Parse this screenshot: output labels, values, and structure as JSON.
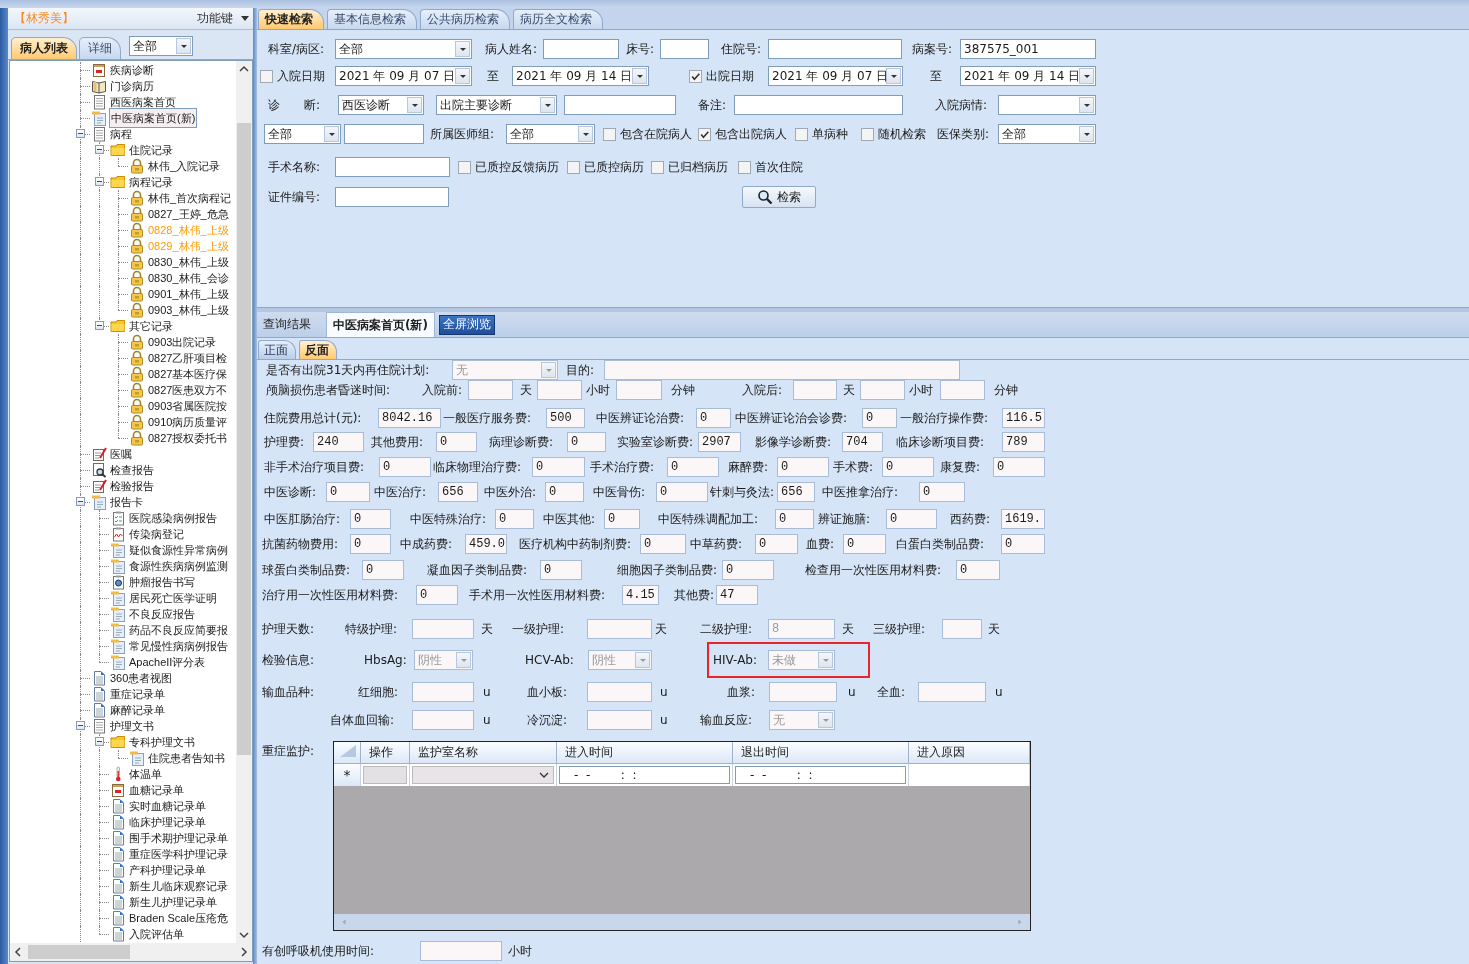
{
  "left_panel": {
    "patient_name": "【林秀美】",
    "function_key": "功能键",
    "tabs": [
      {
        "label": "病人列表",
        "selected": true
      },
      {
        "label": "详细",
        "selected": false
      }
    ],
    "filter": {
      "value": "全部"
    },
    "tree": [
      {
        "label": "疾病诊断",
        "kind": "calendar",
        "selected": false
      },
      {
        "label": "门诊病历",
        "kind": "book",
        "selected": false
      },
      {
        "label": "西医病案首页",
        "kind": "doc",
        "selected": false
      },
      {
        "label": "中医病案首页(新)",
        "kind": "card",
        "selected": true
      },
      {
        "label": "病程",
        "kind": "doc",
        "selected": false,
        "expanded": true,
        "children": [
          {
            "label": "住院记录",
            "kind": "folder",
            "selected": false,
            "expanded": true,
            "children": [
              {
                "label": "林伟_入院记录",
                "kind": "lock",
                "selected": false
              }
            ]
          },
          {
            "label": "病程记录",
            "kind": "folder",
            "selected": false,
            "expanded": true,
            "children": [
              {
                "label": "林伟_首次病程记",
                "kind": "lock",
                "selected": false
              },
              {
                "label": "0827_王婷_危急",
                "kind": "lock",
                "selected": false
              },
              {
                "label": "0828_林伟_上级",
                "kind": "lock",
                "selected": false,
                "color": "#ff9c00"
              },
              {
                "label": "0829_林伟_上级",
                "kind": "lock",
                "selected": false,
                "color": "#ff9c00"
              },
              {
                "label": "0830_林伟_上级",
                "kind": "lock",
                "selected": false
              },
              {
                "label": "0830_林伟_会诊",
                "kind": "lock",
                "selected": false
              },
              {
                "label": "0901_林伟_上级",
                "kind": "lock",
                "selected": false
              },
              {
                "label": "0903_林伟_上级",
                "kind": "lock",
                "selected": false
              }
            ]
          },
          {
            "label": "其它记录",
            "kind": "folder",
            "selected": false,
            "expanded": true,
            "children": [
              {
                "label": "0903出院记录",
                "kind": "lock",
                "selected": false
              },
              {
                "label": "0827乙肝项目检",
                "kind": "lock",
                "selected": false
              },
              {
                "label": "0827基本医疗保",
                "kind": "lock",
                "selected": false
              },
              {
                "label": "0827医患双方不",
                "kind": "lock",
                "selected": false
              },
              {
                "label": "0903省属医院按",
                "kind": "lock",
                "selected": false
              },
              {
                "label": "0910病历质量评",
                "kind": "lock",
                "selected": false
              },
              {
                "label": "0827授权委托书",
                "kind": "lock",
                "selected": false
              }
            ]
          }
        ]
      },
      {
        "label": "医嘱",
        "kind": "pen",
        "selected": false
      },
      {
        "label": "检查报告",
        "kind": "lens",
        "selected": false
      },
      {
        "label": "检验报告",
        "kind": "pen",
        "selected": false
      },
      {
        "label": "报告卡",
        "kind": "card",
        "selected": false,
        "expanded": true,
        "children": [
          {
            "label": "医院感染病例报告",
            "kind": "checklist",
            "selected": false
          },
          {
            "label": "传染病登记",
            "kind": "chart",
            "selected": false
          },
          {
            "label": "疑似食源性异常病例",
            "kind": "card",
            "selected": false
          },
          {
            "label": "食源性疾病病例监测",
            "kind": "card",
            "selected": false
          },
          {
            "label": "肿瘤报告书写",
            "kind": "clipboard",
            "selected": false
          },
          {
            "label": "居民死亡医学证明",
            "kind": "card",
            "selected": false
          },
          {
            "label": "不良反应报告",
            "kind": "card",
            "selected": false
          },
          {
            "label": "药品不良反应简要报",
            "kind": "card",
            "selected": false
          },
          {
            "label": "常见慢性病病例报告",
            "kind": "card",
            "selected": false
          },
          {
            "label": "ApacheII评分表",
            "kind": "card",
            "selected": false
          }
        ]
      },
      {
        "label": "360患者视图",
        "kind": "page",
        "selected": false
      },
      {
        "label": "重症记录单",
        "kind": "page",
        "selected": false
      },
      {
        "label": "麻醉记录单",
        "kind": "page",
        "selected": false
      },
      {
        "label": "护理文书",
        "kind": "doc",
        "selected": false,
        "expanded": true,
        "children": [
          {
            "label": "专科护理文书",
            "kind": "folder",
            "selected": false,
            "expanded": true,
            "children": [
              {
                "label": "住院患者告知书",
                "kind": "card",
                "selected": false
              }
            ]
          },
          {
            "label": "体温单",
            "kind": "thermometer",
            "selected": false
          },
          {
            "label": "血糖记录单",
            "kind": "calendar",
            "selected": false
          },
          {
            "label": "实时血糖记录单",
            "kind": "page",
            "selected": false
          },
          {
            "label": "临床护理记录单",
            "kind": "page",
            "selected": false
          },
          {
            "label": "围手术期护理记录单",
            "kind": "page",
            "selected": false
          },
          {
            "label": "重症医学科护理记录",
            "kind": "page",
            "selected": false
          },
          {
            "label": "产科护理记录单",
            "kind": "page",
            "selected": false
          },
          {
            "label": "新生儿临床观察记录",
            "kind": "page",
            "selected": false
          },
          {
            "label": "新生儿护理记录单",
            "kind": "page",
            "selected": false
          },
          {
            "label": "Braden Scale压疮危",
            "kind": "page",
            "selected": false
          },
          {
            "label": "入院评估单",
            "kind": "page",
            "selected": false
          }
        ]
      }
    ]
  },
  "search_tabs": [
    {
      "label": "快速检索",
      "selected": true
    },
    {
      "label": "基本信息检索",
      "selected": false
    },
    {
      "label": "公共病历检索",
      "selected": false
    },
    {
      "label": "病历全文检索",
      "selected": false
    }
  ],
  "query_form": {
    "rows": [
      {
        "items": [
          {
            "kind": "label",
            "text": "科室/病区:"
          },
          {
            "kind": "select",
            "value": "全部"
          },
          {
            "kind": "label",
            "text": "病人姓名:"
          },
          {
            "kind": "field"
          },
          {
            "kind": "label",
            "text": "床号:"
          },
          {
            "kind": "field"
          },
          {
            "kind": "label",
            "text": "住院号:"
          },
          {
            "kind": "field"
          },
          {
            "kind": "label",
            "text": "病案号:"
          },
          {
            "kind": "field",
            "value": "387575_001"
          }
        ]
      },
      {
        "items": [
          {
            "kind": "check",
            "text": "入院日期",
            "checked": false
          },
          {
            "kind": "date",
            "value": "2021 年 09 月 07 日"
          },
          {
            "kind": "label",
            "text": "至"
          },
          {
            "kind": "date",
            "value": "2021 年 09 月 14 日"
          },
          {
            "kind": "check",
            "text": "出院日期",
            "checked": true
          },
          {
            "kind": "date",
            "value": "2021 年 09 月 07 日"
          },
          {
            "kind": "label",
            "text": "至"
          },
          {
            "kind": "date",
            "value": "2021 年 09 月 14 日"
          }
        ]
      },
      {
        "items": [
          {
            "kind": "label",
            "text": "诊　　断:"
          },
          {
            "kind": "select",
            "value": "西医诊断"
          },
          {
            "kind": "select",
            "value": "出院主要诊断"
          },
          {
            "kind": "field"
          },
          {
            "kind": "label",
            "text": "备注:"
          },
          {
            "kind": "field"
          },
          {
            "kind": "label",
            "text": "入院病情:"
          },
          {
            "kind": "select"
          }
        ]
      },
      {
        "items": [
          {
            "kind": "select",
            "value": "全部"
          },
          {
            "kind": "field"
          },
          {
            "kind": "label",
            "text": "所属医师组:"
          },
          {
            "kind": "select",
            "value": "全部"
          },
          {
            "kind": "check",
            "text": "包含在院病人",
            "checked": false
          },
          {
            "kind": "check",
            "text": "包含出院病人",
            "checked": true
          },
          {
            "kind": "check",
            "text": "单病种",
            "checked": false
          },
          {
            "kind": "check",
            "text": "随机检索",
            "checked": false
          },
          {
            "kind": "label",
            "text": "医保类别:"
          },
          {
            "kind": "select",
            "value": "全部"
          }
        ]
      },
      {
        "items": [
          {
            "kind": "label",
            "text": "手术名称:"
          },
          {
            "kind": "field"
          },
          {
            "kind": "check",
            "text": "已质控反馈病历",
            "checked": false
          },
          {
            "kind": "check",
            "text": "已质控病历",
            "checked": false
          },
          {
            "kind": "check",
            "text": "已归档病历",
            "checked": false
          },
          {
            "kind": "check",
            "text": "首次住院",
            "checked": false
          }
        ]
      },
      {
        "items": [
          {
            "kind": "label",
            "text": "证件编号:"
          },
          {
            "kind": "field"
          },
          {
            "kind": "button",
            "text": "检索"
          }
        ]
      }
    ]
  },
  "result_tabs": [
    {
      "label": "查询结果",
      "selected": false
    },
    {
      "label": "中医病案首页(新)",
      "selected": true
    }
  ],
  "fullscreen_button": "全屏浏览",
  "page_tabs": [
    {
      "label": "正面",
      "selected": false
    },
    {
      "label": "反面",
      "selected": true
    }
  ],
  "back_page": {
    "rows": [
      {
        "items": [
          {
            "kind": "label",
            "text": "是否有出院31天内再住院计划:"
          },
          {
            "kind": "select",
            "value": "无",
            "disabled": true
          },
          {
            "kind": "label",
            "text": "目的:"
          },
          {
            "kind": "field"
          }
        ]
      },
      {
        "items": [
          {
            "kind": "label",
            "text": "颅脑损伤患者昏迷时间:"
          },
          {
            "kind": "label",
            "text": "入院前:"
          },
          {
            "kind": "field"
          },
          {
            "kind": "unit",
            "text": "天"
          },
          {
            "kind": "field"
          },
          {
            "kind": "unit",
            "text": "小时"
          },
          {
            "kind": "field"
          },
          {
            "kind": "unit",
            "text": "分钟"
          },
          {
            "kind": "label",
            "text": "入院后:"
          },
          {
            "kind": "field"
          },
          {
            "kind": "unit",
            "text": "天"
          },
          {
            "kind": "field"
          },
          {
            "kind": "unit",
            "text": "小时"
          },
          {
            "kind": "field"
          },
          {
            "kind": "unit",
            "text": "分钟"
          }
        ]
      },
      {
        "items": [
          {
            "kind": "label",
            "text": "住院费用总计(元):"
          },
          {
            "kind": "field",
            "value": "8042.16"
          },
          {
            "kind": "label",
            "text": "一般医疗服务费:"
          },
          {
            "kind": "field",
            "value": "500"
          },
          {
            "kind": "label",
            "text": "中医辨证论治费:"
          },
          {
            "kind": "field",
            "value": "0"
          },
          {
            "kind": "label",
            "text": "中医辨证论治会诊费:"
          },
          {
            "kind": "field",
            "value": "0"
          },
          {
            "kind": "label",
            "text": "一般治疗操作费:"
          },
          {
            "kind": "field",
            "value": "116.5"
          }
        ]
      },
      {
        "items": [
          {
            "kind": "label",
            "text": "护理费:"
          },
          {
            "kind": "field",
            "value": "240"
          },
          {
            "kind": "label",
            "text": "其他费用:"
          },
          {
            "kind": "field",
            "value": "0"
          },
          {
            "kind": "label",
            "text": "病理诊断费:"
          },
          {
            "kind": "field",
            "value": "0"
          },
          {
            "kind": "label",
            "text": "实验室诊断费:"
          },
          {
            "kind": "field",
            "value": "2907"
          },
          {
            "kind": "label",
            "text": "影像学诊断费:"
          },
          {
            "kind": "field",
            "value": "704"
          },
          {
            "kind": "label",
            "text": "临床诊断项目费:"
          },
          {
            "kind": "field",
            "value": "789"
          }
        ]
      },
      {
        "items": [
          {
            "kind": "label",
            "text": "非手术治疗项目费:"
          },
          {
            "kind": "field",
            "value": "0"
          },
          {
            "kind": "label",
            "text": "临床物理治疗费:"
          },
          {
            "kind": "field",
            "value": "0"
          },
          {
            "kind": "label",
            "text": "手术治疗费:"
          },
          {
            "kind": "field",
            "value": "0"
          },
          {
            "kind": "label",
            "text": "麻醉费:"
          },
          {
            "kind": "field",
            "value": "0"
          },
          {
            "kind": "label",
            "text": "手术费:"
          },
          {
            "kind": "field",
            "value": "0"
          },
          {
            "kind": "label",
            "text": "康复费:"
          },
          {
            "kind": "field",
            "value": "0"
          }
        ]
      },
      {
        "items": [
          {
            "kind": "label",
            "text": "中医诊断:"
          },
          {
            "kind": "field",
            "value": "0"
          },
          {
            "kind": "label",
            "text": "中医治疗:"
          },
          {
            "kind": "field",
            "value": "656"
          },
          {
            "kind": "label",
            "text": "中医外治:"
          },
          {
            "kind": "field",
            "value": "0"
          },
          {
            "kind": "label",
            "text": "中医骨伤:"
          },
          {
            "kind": "field",
            "value": "0"
          },
          {
            "kind": "label",
            "text": "针刺与灸法:"
          },
          {
            "kind": "field",
            "value": "656"
          },
          {
            "kind": "label",
            "text": "中医推拿治疗:"
          },
          {
            "kind": "field",
            "value": "0"
          }
        ]
      },
      {
        "items": [
          {
            "kind": "label",
            "text": "中医肛肠治疗:"
          },
          {
            "kind": "field",
            "value": "0"
          },
          {
            "kind": "label",
            "text": "中医特殊治疗:"
          },
          {
            "kind": "field",
            "value": "0"
          },
          {
            "kind": "label",
            "text": "中医其他:"
          },
          {
            "kind": "field",
            "value": "0"
          },
          {
            "kind": "label",
            "text": "中医特殊调配加工:"
          },
          {
            "kind": "field",
            "value": "0"
          },
          {
            "kind": "label",
            "text": "辨证施膳:"
          },
          {
            "kind": "field",
            "value": "0"
          },
          {
            "kind": "label",
            "text": "西药费:"
          },
          {
            "kind": "field",
            "value": "1619."
          }
        ]
      },
      {
        "items": [
          {
            "kind": "label",
            "text": "抗菌药物费用:"
          },
          {
            "kind": "field",
            "value": "0"
          },
          {
            "kind": "label",
            "text": "中成药费:"
          },
          {
            "kind": "field",
            "value": "459.0"
          },
          {
            "kind": "label",
            "text": "医疗机构中药制剂费:"
          },
          {
            "kind": "field",
            "value": "0"
          },
          {
            "kind": "label",
            "text": "中草药费:"
          },
          {
            "kind": "field",
            "value": "0"
          },
          {
            "kind": "label",
            "text": "血费:"
          },
          {
            "kind": "field",
            "value": "0"
          },
          {
            "kind": "label",
            "text": "白蛋白类制品费:"
          },
          {
            "kind": "field",
            "value": "0"
          }
        ]
      },
      {
        "items": [
          {
            "kind": "label",
            "text": "球蛋白类制品费:"
          },
          {
            "kind": "field",
            "value": "0"
          },
          {
            "kind": "label",
            "text": "凝血因子类制品费:"
          },
          {
            "kind": "field",
            "value": "0"
          },
          {
            "kind": "label",
            "text": "细胞因子类制品费:"
          },
          {
            "kind": "field",
            "value": "0"
          },
          {
            "kind": "label",
            "text": "检查用一次性医用材料费:"
          },
          {
            "kind": "field",
            "value": "0"
          }
        ]
      },
      {
        "items": [
          {
            "kind": "label",
            "text": "治疗用一次性医用材料费:"
          },
          {
            "kind": "field",
            "value": "0"
          },
          {
            "kind": "label",
            "text": "手术用一次性医用材料费:"
          },
          {
            "kind": "field",
            "value": "4.15"
          },
          {
            "kind": "label",
            "text": "其他费:"
          },
          {
            "kind": "field",
            "value": "47"
          }
        ]
      },
      {
        "items": [
          {
            "kind": "label",
            "text": "护理天数:"
          },
          {
            "kind": "label",
            "text": "特级护理:"
          },
          {
            "kind": "field"
          },
          {
            "kind": "unit",
            "text": "天"
          },
          {
            "kind": "label",
            "text": "一级护理:"
          },
          {
            "kind": "field"
          },
          {
            "kind": "unit",
            "text": "天"
          },
          {
            "kind": "label",
            "text": "二级护理:"
          },
          {
            "kind": "field",
            "value": "8",
            "disabled": true
          },
          {
            "kind": "unit",
            "text": "天"
          },
          {
            "kind": "label",
            "text": "三级护理:"
          },
          {
            "kind": "field"
          },
          {
            "kind": "unit",
            "text": "天"
          }
        ]
      },
      {
        "items": [
          {
            "kind": "label",
            "text": "检验信息:"
          },
          {
            "kind": "label",
            "text": "HbsAg:"
          },
          {
            "kind": "select",
            "value": "阴性",
            "disabled": true
          },
          {
            "kind": "label",
            "text": "HCV-Ab:"
          },
          {
            "kind": "select",
            "value": "阴性",
            "disabled": true
          },
          {
            "kind": "group",
            "flagged": true,
            "items": [
              {
                "kind": "label",
                "text": "HIV-Ab:"
              },
              {
                "kind": "select",
                "value": "未做",
                "disabled": true
              }
            ]
          }
        ]
      },
      {
        "items": [
          {
            "kind": "label",
            "text": "输血品种:"
          },
          {
            "kind": "label",
            "text": "红细胞:"
          },
          {
            "kind": "field"
          },
          {
            "kind": "unit",
            "text": "u"
          },
          {
            "kind": "label",
            "text": "血小板:"
          },
          {
            "kind": "field"
          },
          {
            "kind": "unit",
            "text": "u"
          },
          {
            "kind": "label",
            "text": "血浆:"
          },
          {
            "kind": "field"
          },
          {
            "kind": "unit",
            "text": "u"
          },
          {
            "kind": "label",
            "text": "全血:"
          },
          {
            "kind": "field"
          },
          {
            "kind": "unit",
            "text": "u"
          }
        ]
      },
      {
        "items": [
          {
            "kind": "label",
            "text": "自体血回输:"
          },
          {
            "kind": "field"
          },
          {
            "kind": "unit",
            "text": "u"
          },
          {
            "kind": "label",
            "text": "冷沉淀:"
          },
          {
            "kind": "field"
          },
          {
            "kind": "unit",
            "text": "u"
          },
          {
            "kind": "label",
            "text": "输血反应:"
          },
          {
            "kind": "select",
            "value": "无",
            "disabled": true
          }
        ]
      }
    ]
  },
  "icu_monitor": {
    "label": "重症监护:",
    "columns": [
      "操作",
      "监护室名称",
      "进入时间",
      "退出时间",
      "进入原因"
    ],
    "new_row": {
      "marker": "*",
      "entry_time": "-  -        :  :",
      "exit_time": "-  -        :  :"
    }
  },
  "ventilator": {
    "items": [
      {
        "kind": "label",
        "text": "有创呼吸机使用时间:"
      },
      {
        "kind": "field"
      },
      {
        "kind": "unit",
        "text": "小时"
      }
    ]
  }
}
